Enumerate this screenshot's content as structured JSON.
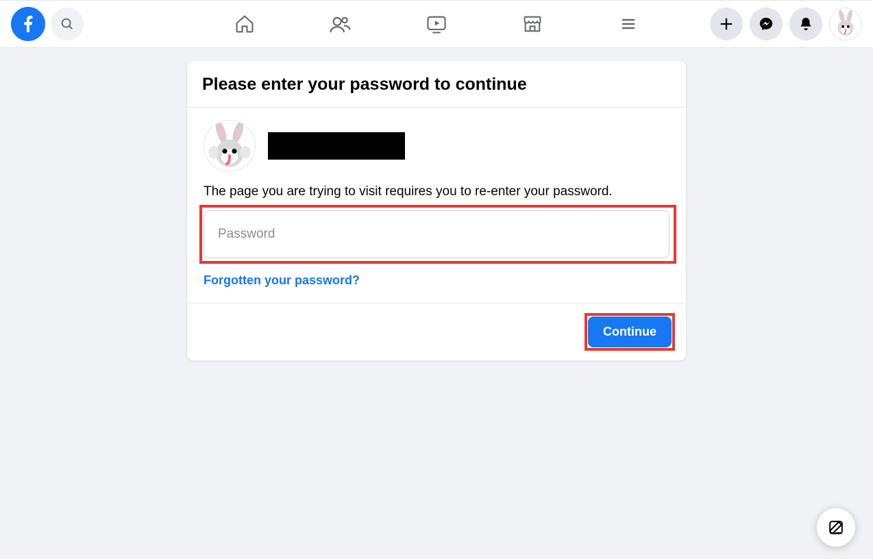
{
  "header": {
    "nav": {
      "home": "Home",
      "friends": "Friends",
      "watch": "Watch",
      "marketplace": "Marketplace",
      "menu": "Menu"
    }
  },
  "dialog": {
    "title": "Please enter your password to continue",
    "info": "The page you are trying to visit requires you to re-enter your password.",
    "password_placeholder": "Password",
    "forgot_link": "Forgotten your password?",
    "continue_label": "Continue"
  }
}
